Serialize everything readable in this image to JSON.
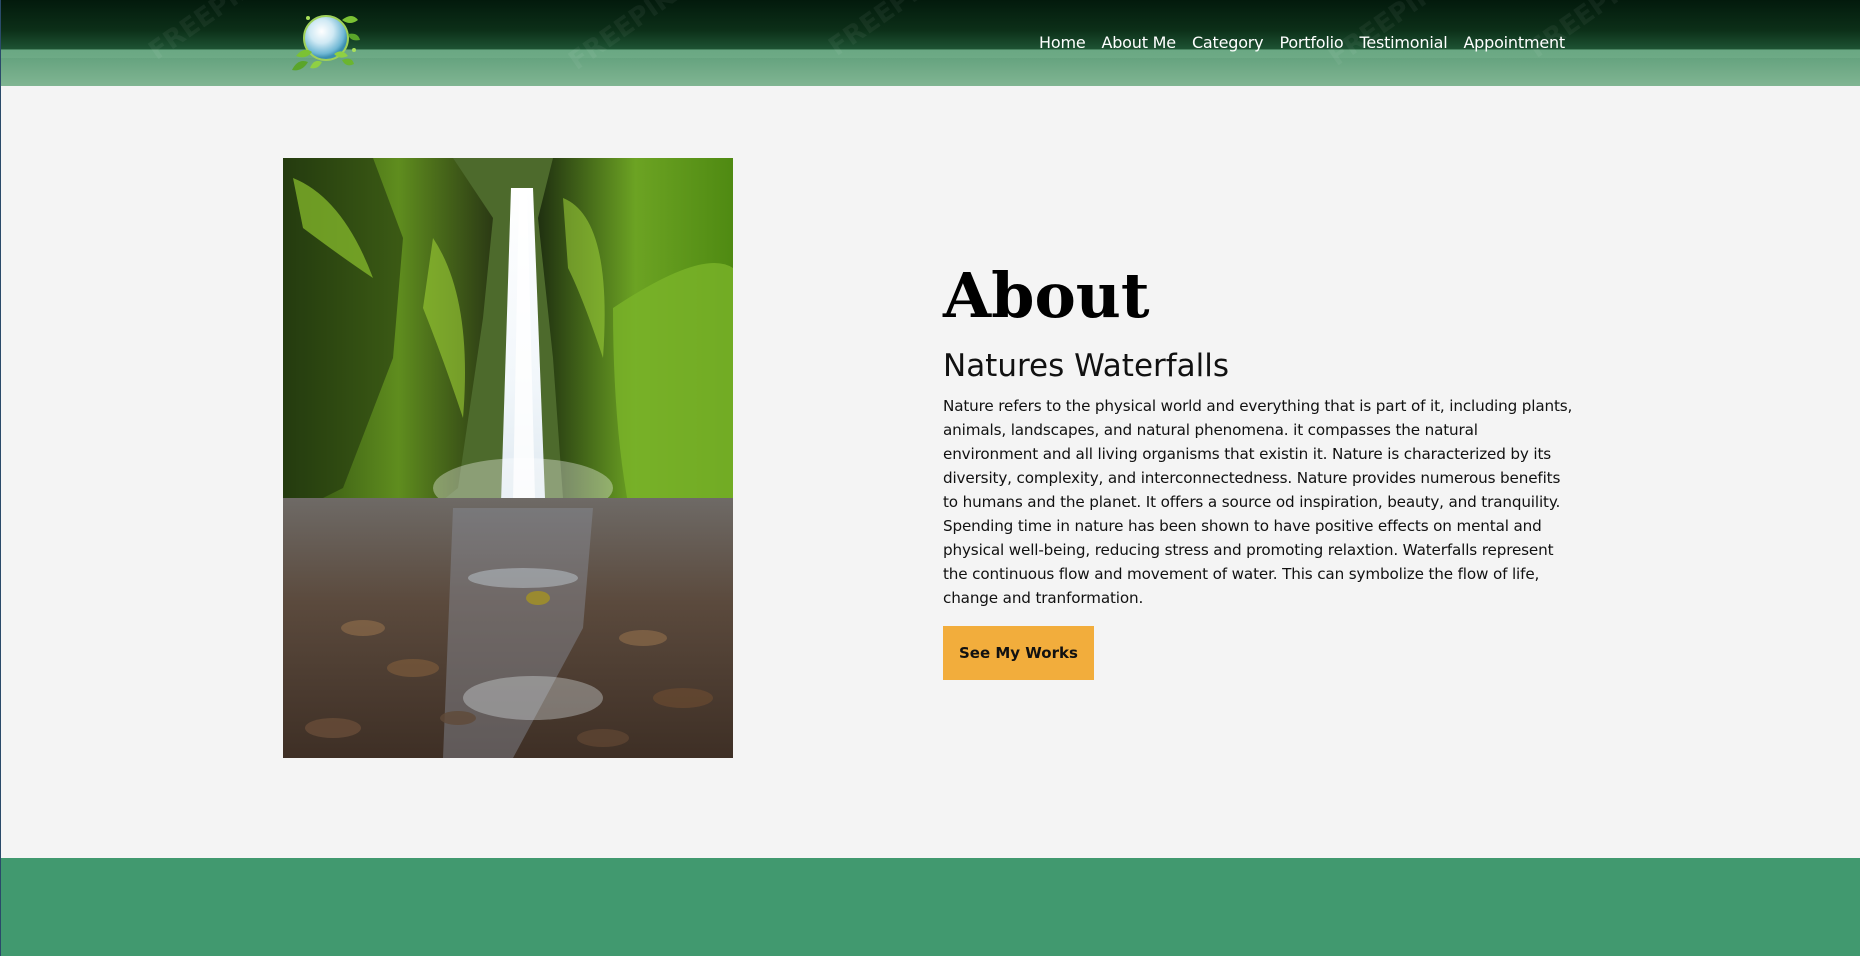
{
  "nav": {
    "items": [
      "Home",
      "About Me",
      "Category",
      "Portfolio",
      "Testimonial",
      "Appointment"
    ]
  },
  "about": {
    "title": "About",
    "subtitle": "Natures Waterfalls",
    "body": "Nature refers to the physical world and everything that is part of it, including plants, animals, landscapes, and natural phenomena. it compasses the natural environment and all living organisms that existin it. Nature is characterized by its diversity, complexity, and interconnectedness. Nature provides numerous benefits to humans and the planet. It offers a source od inspiration, beauty, and tranquility. Spending time in nature has been shown to have positive effects on mental and physical well-being, reducing stress and promoting relaxtion. Waterfalls represent the continuous flow and movement of water. This can symbolize the flow of life, change and tranformation.",
    "cta_label": "See My Works"
  },
  "colors": {
    "header_dark": "#031a0c",
    "header_strip": "#7ab08e",
    "background": "#f4f4f4",
    "cta": "#f2ad3c",
    "footer": "#41996f"
  },
  "icons": {
    "logo": "globe-with-leaves-icon"
  }
}
